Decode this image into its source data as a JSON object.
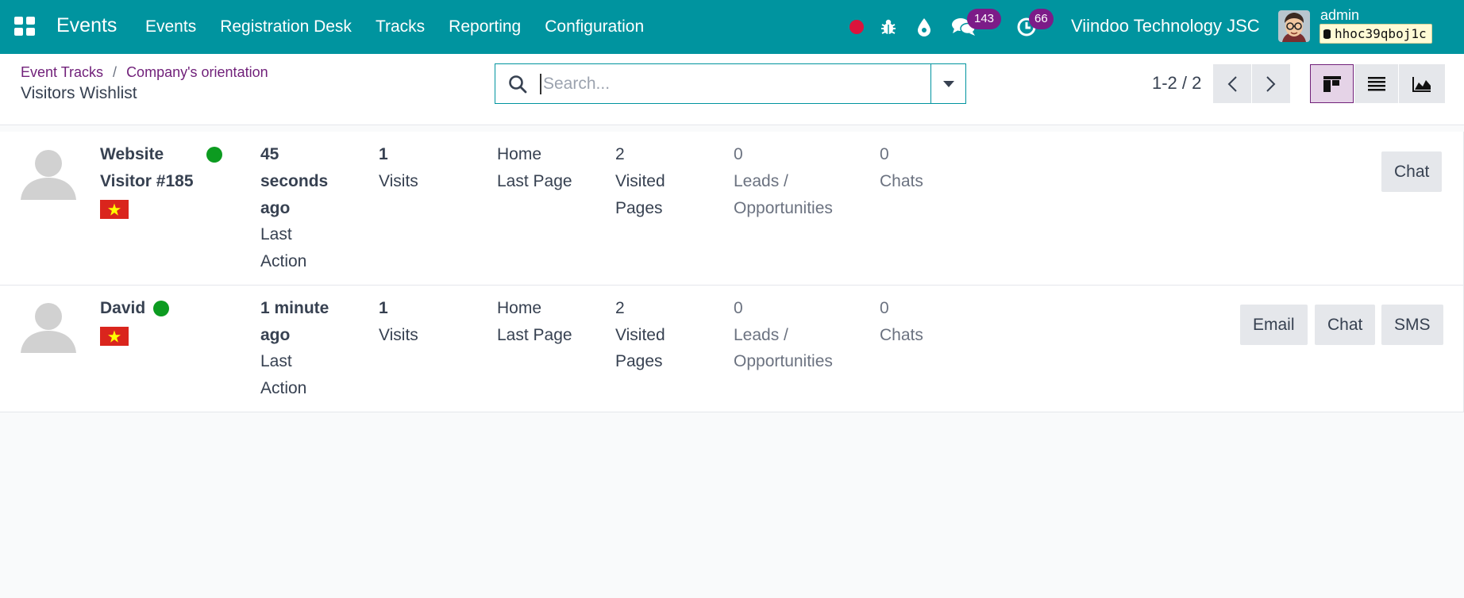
{
  "navbar": {
    "app_title": "Events",
    "menu": [
      "Events",
      "Registration Desk",
      "Tracks",
      "Reporting",
      "Configuration"
    ],
    "chat_count": "143",
    "activity_count": "66",
    "company": "Viindoo Technology JSC",
    "user": "admin",
    "database": "hhoc39qboj1c",
    "icons": [
      "apps-grid-icon",
      "recording-dot-icon",
      "bug-icon",
      "water-drop-icon",
      "chat-bubbles-icon",
      "clock-icon"
    ],
    "colors": {
      "bar": "#00949f",
      "badge": "#7c1c88",
      "record": "#dc143c"
    }
  },
  "breadcrumb": [
    "Event Tracks",
    "Company's orientation"
  ],
  "breadcrumb_separator": "/",
  "page_title": "Visitors Wishlist",
  "search": {
    "placeholder": "Search..."
  },
  "pager": {
    "text": "1-2 / 2"
  },
  "visitors": [
    {
      "name_line1": "Website",
      "name_line2": "Visitor #185",
      "online": true,
      "country": "Vietnam",
      "last_action_value": [
        "45",
        "seconds",
        "ago"
      ],
      "last_action_label": [
        "Last",
        "Action"
      ],
      "visits_value": "1",
      "visits_label": "Visits",
      "last_page_value": "Home",
      "last_page_label": "Last Page",
      "visited_pages_value": "2",
      "visited_pages_label": [
        "Visited",
        "Pages"
      ],
      "leads_value": "0",
      "leads_label": [
        "Leads /",
        "Opportunities"
      ],
      "chats_value": "0",
      "chats_label": "Chats",
      "actions": [
        "Chat"
      ]
    },
    {
      "name_line1": "David",
      "online": true,
      "country": "Vietnam",
      "last_action_value": [
        "1 minute",
        "ago"
      ],
      "last_action_label": [
        "Last",
        "Action"
      ],
      "visits_value": "1",
      "visits_label": "Visits",
      "last_page_value": "Home",
      "last_page_label": "Last Page",
      "visited_pages_value": "2",
      "visited_pages_label": [
        "Visited",
        "Pages"
      ],
      "leads_value": "0",
      "leads_label": [
        "Leads /",
        "Opportunities"
      ],
      "chats_value": "0",
      "chats_label": "Chats",
      "actions": [
        "Email",
        "Chat",
        "SMS"
      ]
    }
  ]
}
